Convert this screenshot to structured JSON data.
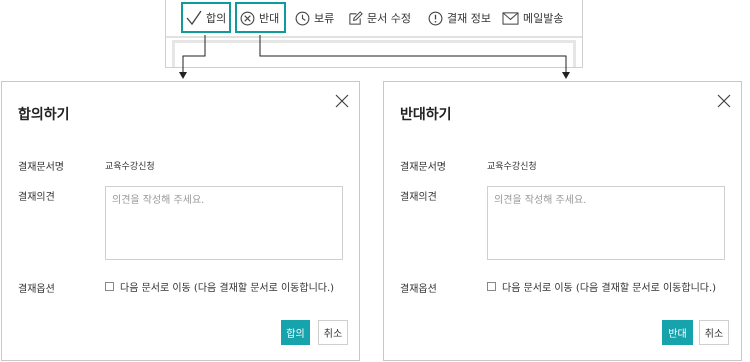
{
  "toolbar": {
    "items": [
      {
        "label": "합의",
        "icon": "check-icon"
      },
      {
        "label": "반대",
        "icon": "circle-x-icon"
      },
      {
        "label": "보류",
        "icon": "clock-icon"
      },
      {
        "label": "문서 수정",
        "icon": "edit-icon"
      },
      {
        "label": "결재 정보",
        "icon": "info-circle-icon"
      },
      {
        "label": "메일발송",
        "icon": "mail-icon"
      }
    ],
    "highlight_color": "#109b9b"
  },
  "agree_dialog": {
    "title": "합의하기",
    "doc_label": "결재문서명",
    "doc_value": "교육수강신청",
    "opinion_label": "결재의견",
    "opinion_placeholder": "의견을 작성해 주세요.",
    "option_label": "결재옵션",
    "option_text": "다음 문서로 이동 (다음 결재할 문서로 이동합니다.)",
    "primary_button": "합의",
    "cancel_button": "취소"
  },
  "reject_dialog": {
    "title": "반대하기",
    "doc_label": "결재문서명",
    "doc_value": "교육수강신청",
    "opinion_label": "결재의견",
    "opinion_placeholder": "의견을 작성해 주세요.",
    "option_label": "결재옵션",
    "option_text": "다음 문서로 이동 (다음 결재할 문서로 이동합니다.)",
    "primary_button": "반대",
    "cancel_button": "취소"
  },
  "colors": {
    "accent": "#17a3ab",
    "border": "#c8c8c8"
  }
}
